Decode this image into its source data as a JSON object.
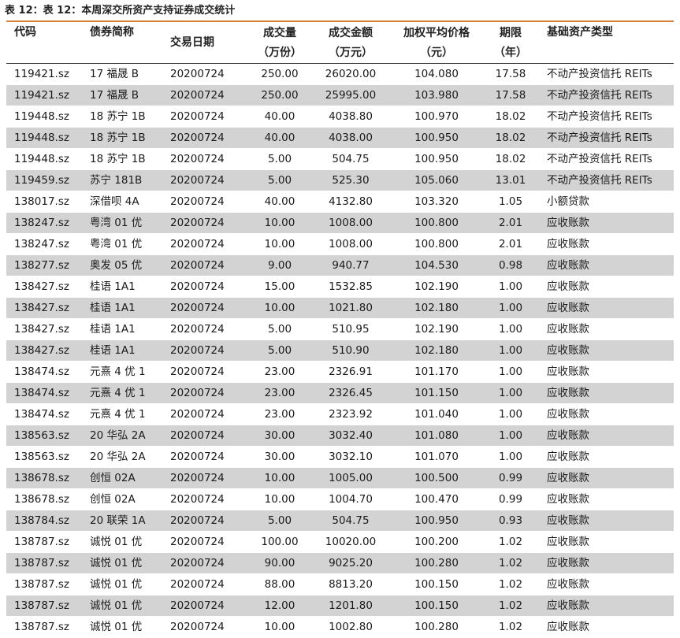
{
  "caption": "表 12：表 12：本周深交所资产支持证券成交统计",
  "accent_color": "#d9813a",
  "stripe_color": "#d3d3d3",
  "headers": {
    "code": [
      "代码"
    ],
    "name": [
      "债券简称"
    ],
    "date": [
      "交易日期"
    ],
    "volume": [
      "成交量",
      "（万份）"
    ],
    "amount": [
      "成交金额",
      "（万元）"
    ],
    "price": [
      "加权平均价格",
      "（元）"
    ],
    "term": [
      "期限",
      "（年）"
    ],
    "asset_type": [
      "基础资产类型"
    ]
  },
  "rows": [
    {
      "code": "119421.sz",
      "name": "17 福晟 B",
      "date": "20200724",
      "volume": "250.00",
      "amount": "26020.00",
      "price": "104.080",
      "term": "17.58",
      "asset_type": "不动产投资信托 REITs"
    },
    {
      "code": "119421.sz",
      "name": "17 福晟 B",
      "date": "20200724",
      "volume": "250.00",
      "amount": "25995.00",
      "price": "103.980",
      "term": "17.58",
      "asset_type": "不动产投资信托 REITs"
    },
    {
      "code": "119448.sz",
      "name": "18 苏宁 1B",
      "date": "20200724",
      "volume": "40.00",
      "amount": "4038.80",
      "price": "100.970",
      "term": "18.02",
      "asset_type": "不动产投资信托 REITs"
    },
    {
      "code": "119448.sz",
      "name": "18 苏宁 1B",
      "date": "20200724",
      "volume": "40.00",
      "amount": "4038.00",
      "price": "100.950",
      "term": "18.02",
      "asset_type": "不动产投资信托 REITs"
    },
    {
      "code": "119448.sz",
      "name": "18 苏宁 1B",
      "date": "20200724",
      "volume": "5.00",
      "amount": "504.75",
      "price": "100.950",
      "term": "18.02",
      "asset_type": "不动产投资信托 REITs"
    },
    {
      "code": "119459.sz",
      "name": "苏宁 181B",
      "date": "20200724",
      "volume": "5.00",
      "amount": "525.30",
      "price": "105.060",
      "term": "13.01",
      "asset_type": "不动产投资信托 REITs"
    },
    {
      "code": "138017.sz",
      "name": "深借呗 4A",
      "date": "20200724",
      "volume": "40.00",
      "amount": "4132.80",
      "price": "103.320",
      "term": "1.05",
      "asset_type": "小额贷款"
    },
    {
      "code": "138247.sz",
      "name": "粤湾 01 优",
      "date": "20200724",
      "volume": "10.00",
      "amount": "1008.00",
      "price": "100.800",
      "term": "2.01",
      "asset_type": "应收账款"
    },
    {
      "code": "138247.sz",
      "name": "粤湾 01 优",
      "date": "20200724",
      "volume": "10.00",
      "amount": "1008.00",
      "price": "100.800",
      "term": "2.01",
      "asset_type": "应收账款"
    },
    {
      "code": "138277.sz",
      "name": "奥发 05 优",
      "date": "20200724",
      "volume": "9.00",
      "amount": "940.77",
      "price": "104.530",
      "term": "0.98",
      "asset_type": "应收账款"
    },
    {
      "code": "138427.sz",
      "name": "桂语 1A1",
      "date": "20200724",
      "volume": "15.00",
      "amount": "1532.85",
      "price": "102.190",
      "term": "1.00",
      "asset_type": "应收账款"
    },
    {
      "code": "138427.sz",
      "name": "桂语 1A1",
      "date": "20200724",
      "volume": "10.00",
      "amount": "1021.80",
      "price": "102.180",
      "term": "1.00",
      "asset_type": "应收账款"
    },
    {
      "code": "138427.sz",
      "name": "桂语 1A1",
      "date": "20200724",
      "volume": "5.00",
      "amount": "510.95",
      "price": "102.190",
      "term": "1.00",
      "asset_type": "应收账款"
    },
    {
      "code": "138427.sz",
      "name": "桂语 1A1",
      "date": "20200724",
      "volume": "5.00",
      "amount": "510.90",
      "price": "102.180",
      "term": "1.00",
      "asset_type": "应收账款"
    },
    {
      "code": "138474.sz",
      "name": "元熹 4 优 1",
      "date": "20200724",
      "volume": "23.00",
      "amount": "2326.91",
      "price": "101.170",
      "term": "1.00",
      "asset_type": "应收账款"
    },
    {
      "code": "138474.sz",
      "name": "元熹 4 优 1",
      "date": "20200724",
      "volume": "23.00",
      "amount": "2326.45",
      "price": "101.150",
      "term": "1.00",
      "asset_type": "应收账款"
    },
    {
      "code": "138474.sz",
      "name": "元熹 4 优 1",
      "date": "20200724",
      "volume": "23.00",
      "amount": "2323.92",
      "price": "101.040",
      "term": "1.00",
      "asset_type": "应收账款"
    },
    {
      "code": "138563.sz",
      "name": "20 华弘 2A",
      "date": "20200724",
      "volume": "30.00",
      "amount": "3032.40",
      "price": "101.080",
      "term": "1.00",
      "asset_type": "应收账款"
    },
    {
      "code": "138563.sz",
      "name": "20 华弘 2A",
      "date": "20200724",
      "volume": "30.00",
      "amount": "3032.10",
      "price": "101.070",
      "term": "1.00",
      "asset_type": "应收账款"
    },
    {
      "code": "138678.sz",
      "name": "创恒 02A",
      "date": "20200724",
      "volume": "10.00",
      "amount": "1005.00",
      "price": "100.500",
      "term": "0.99",
      "asset_type": "应收账款"
    },
    {
      "code": "138678.sz",
      "name": "创恒 02A",
      "date": "20200724",
      "volume": "10.00",
      "amount": "1004.70",
      "price": "100.470",
      "term": "0.99",
      "asset_type": "应收账款"
    },
    {
      "code": "138784.sz",
      "name": "20 联荣 1A",
      "date": "20200724",
      "volume": "5.00",
      "amount": "504.75",
      "price": "100.950",
      "term": "0.93",
      "asset_type": "应收账款"
    },
    {
      "code": "138787.sz",
      "name": "诚悦 01 优",
      "date": "20200724",
      "volume": "100.00",
      "amount": "10020.00",
      "price": "100.200",
      "term": "1.02",
      "asset_type": "应收账款"
    },
    {
      "code": "138787.sz",
      "name": "诚悦 01 优",
      "date": "20200724",
      "volume": "90.00",
      "amount": "9025.20",
      "price": "100.280",
      "term": "1.02",
      "asset_type": "应收账款"
    },
    {
      "code": "138787.sz",
      "name": "诚悦 01 优",
      "date": "20200724",
      "volume": "88.00",
      "amount": "8813.20",
      "price": "100.150",
      "term": "1.02",
      "asset_type": "应收账款"
    },
    {
      "code": "138787.sz",
      "name": "诚悦 01 优",
      "date": "20200724",
      "volume": "12.00",
      "amount": "1201.80",
      "price": "100.150",
      "term": "1.02",
      "asset_type": "应收账款"
    },
    {
      "code": "138787.sz",
      "name": "诚悦 01 优",
      "date": "20200724",
      "volume": "10.00",
      "amount": "1002.80",
      "price": "100.280",
      "term": "1.02",
      "asset_type": "应收账款"
    }
  ]
}
